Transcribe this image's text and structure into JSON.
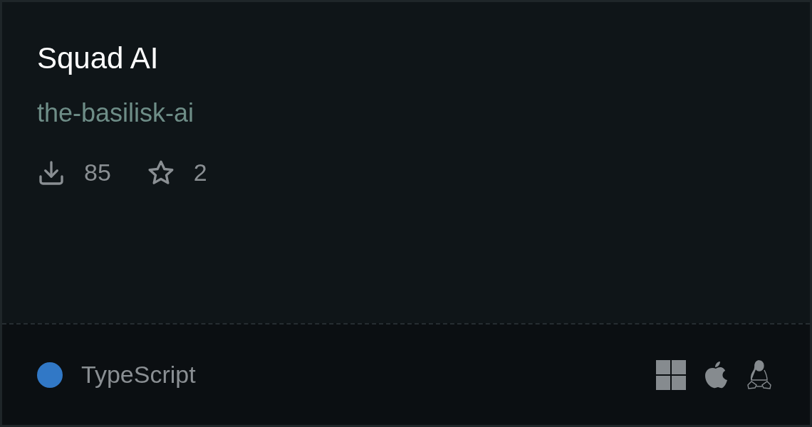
{
  "title": "Squad AI",
  "author": "the-basilisk-ai",
  "stats": [
    {
      "kind": "downloads",
      "value": "85"
    },
    {
      "kind": "stars",
      "value": "2"
    }
  ],
  "language": {
    "name": "TypeScript",
    "color": "#3178c6"
  },
  "platforms": [
    {
      "kind": "windows"
    },
    {
      "kind": "apple"
    },
    {
      "kind": "linux"
    }
  ]
}
